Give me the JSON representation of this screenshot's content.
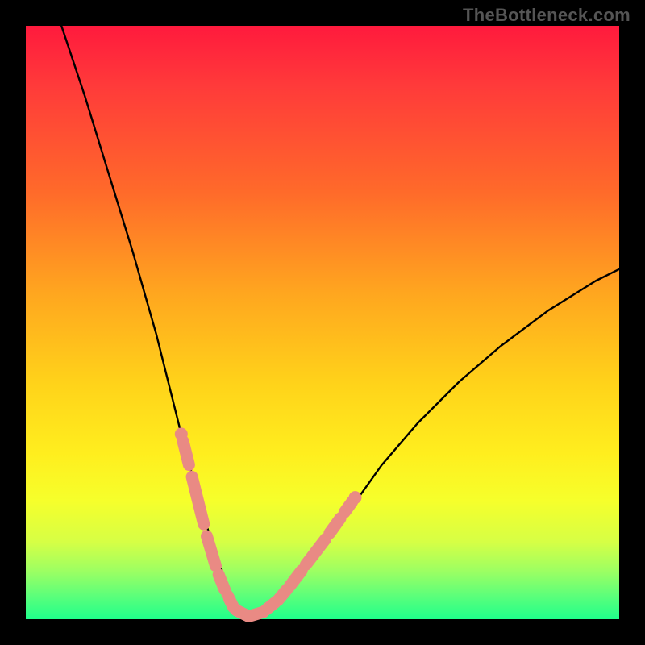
{
  "brand": "TheBottleneck.com",
  "colors": {
    "curve": "#000000",
    "marker_fill": "#e98a84",
    "marker_stroke": "#d76f69",
    "gradient_top": "#ff1a3d",
    "gradient_bottom": "#1fff8b",
    "page_bg": "#000000"
  },
  "chart_data": {
    "type": "line",
    "title": "",
    "xlabel": "",
    "ylabel": "",
    "xlim": [
      0,
      100
    ],
    "ylim": [
      0,
      100
    ],
    "grid": false,
    "legend": false,
    "annotations": [],
    "series": [
      {
        "name": "bottleneck-curve",
        "x": [
          6,
          10,
          14,
          18,
          22,
          25,
          27,
          29,
          31,
          33,
          34,
          35,
          36,
          37,
          38,
          40,
          43,
          46,
          50,
          55,
          60,
          66,
          73,
          80,
          88,
          96,
          100
        ],
        "y": [
          100,
          88,
          75,
          62,
          48,
          36,
          28,
          21,
          14,
          8,
          5,
          3,
          1,
          0.5,
          0.5,
          1,
          3,
          7,
          12,
          19,
          26,
          33,
          40,
          46,
          52,
          57,
          59
        ]
      }
    ],
    "markers": {
      "name": "highlighted-range",
      "note": "pink pill segments near the valley",
      "segments": [
        {
          "x1": 26.5,
          "y1": 30,
          "x2": 27.5,
          "y2": 26
        },
        {
          "x1": 28.0,
          "y1": 24,
          "x2": 30.0,
          "y2": 16
        },
        {
          "x1": 30.5,
          "y1": 14,
          "x2": 32.0,
          "y2": 9
        },
        {
          "x1": 32.5,
          "y1": 7.5,
          "x2": 33.5,
          "y2": 5
        },
        {
          "x1": 34.0,
          "y1": 4,
          "x2": 35.0,
          "y2": 2
        },
        {
          "x1": 35.5,
          "y1": 1.5,
          "x2": 37.5,
          "y2": 0.5
        },
        {
          "x1": 38.0,
          "y1": 0.6,
          "x2": 40.0,
          "y2": 1.2
        },
        {
          "x1": 40.5,
          "y1": 1.6,
          "x2": 42.0,
          "y2": 2.8
        },
        {
          "x1": 42.5,
          "y1": 3.2,
          "x2": 44.0,
          "y2": 5.0
        },
        {
          "x1": 44.5,
          "y1": 5.6,
          "x2": 46.5,
          "y2": 8.2
        },
        {
          "x1": 47.2,
          "y1": 9.2,
          "x2": 50.5,
          "y2": 13.5
        },
        {
          "x1": 51.2,
          "y1": 14.5,
          "x2": 53.0,
          "y2": 17.0
        },
        {
          "x1": 53.7,
          "y1": 18.0,
          "x2": 55.0,
          "y2": 19.8
        }
      ],
      "end_dots": [
        {
          "x": 26.2,
          "y": 31.2
        },
        {
          "x": 55.5,
          "y": 20.5
        }
      ]
    }
  }
}
